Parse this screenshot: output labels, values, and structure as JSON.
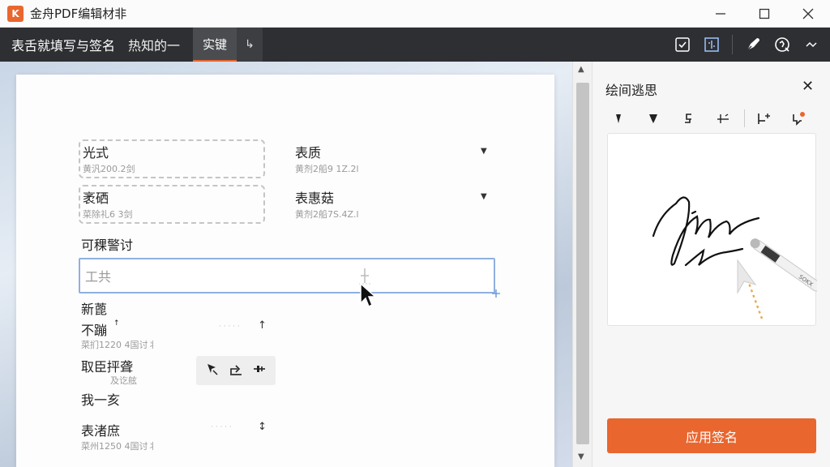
{
  "window": {
    "title": "金舟PDF编辑材非",
    "logo_text": "K"
  },
  "toolbar": {
    "title": "表舌就填写与签名",
    "tab_1": "热知的一",
    "tab_active": "实键",
    "arrow": "↳"
  },
  "form": {
    "field1_label": "光式",
    "field1_hint": "黄汎200.2剑",
    "field2_label": "表质",
    "field2_hint": "黄剂2船9 1Z.2l",
    "field3_label": "袤硒",
    "field3_hint": "菜除礼6 3剑",
    "field4_label": "表惠菇",
    "field4_hint": "黄剂2船7S.4Z.l",
    "section_label": "可稞警讨",
    "input_value": "工共",
    "item1_label": "新蓖",
    "item2_label": "不蹦",
    "item2_hint": "菜扪1220 4国讨丬",
    "item2_dots": "· · · · ·",
    "item3_label": "取臣抨聋",
    "item3_sub": "及讫舷",
    "item4_label": "我一亥",
    "item5_label": "表渚庶",
    "item5_hint": "菜州1250 4国讨丬",
    "item5_dots": "· · · · ·"
  },
  "panel": {
    "title": "绘间逃思",
    "close": "✕",
    "apply_label": "应用签名",
    "pen_brand": "SOKX"
  },
  "colors": {
    "accent": "#e9662f",
    "toolbar_bg": "#2d2f32",
    "focus_border": "#8fb0e0"
  }
}
